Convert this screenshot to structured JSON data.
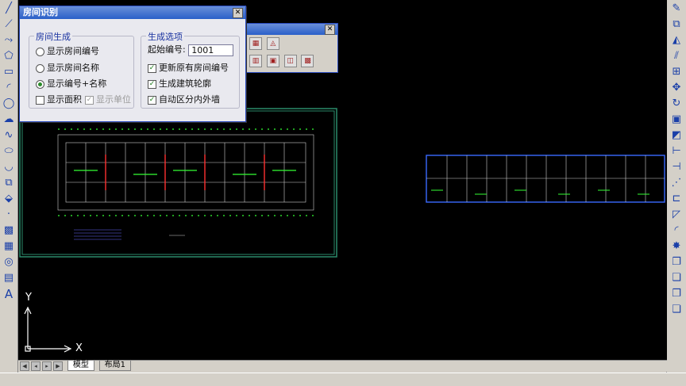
{
  "dialog": {
    "title": "房间识别",
    "close_glyph": "✕",
    "group_generate": {
      "title": "房间生成",
      "opt_number": "显示房间编号",
      "opt_name": "显示房间名称",
      "opt_both": "显示编号+名称",
      "selected": "显示编号+名称",
      "chk_area": "显示面积",
      "chk_area_checked": false,
      "chk_unit": "显示单位",
      "chk_unit_checked": true,
      "chk_unit_enabled": false
    },
    "group_options": {
      "title": "生成选项",
      "start_label": "起始编号:",
      "start_value": "1001",
      "chk_update": "更新原有房间编号",
      "chk_update_checked": true,
      "chk_outline": "生成建筑轮廓",
      "chk_outline_checked": true,
      "chk_walls": "自动区分内外墙",
      "chk_walls_checked": true
    }
  },
  "toolbar2": {
    "close_glyph": "✕"
  },
  "canvas": {
    "axis_y": "Y",
    "axis_x": "X",
    "background": "#000000",
    "drawing_color": "#2a6a2a",
    "plan_line_color": "#cfcfcf",
    "accent_green": "#33ff33",
    "accent_red": "#ff3030",
    "accent_blue": "#3a6aff"
  },
  "tabs": {
    "model": "模型",
    "layout1": "布局1"
  }
}
